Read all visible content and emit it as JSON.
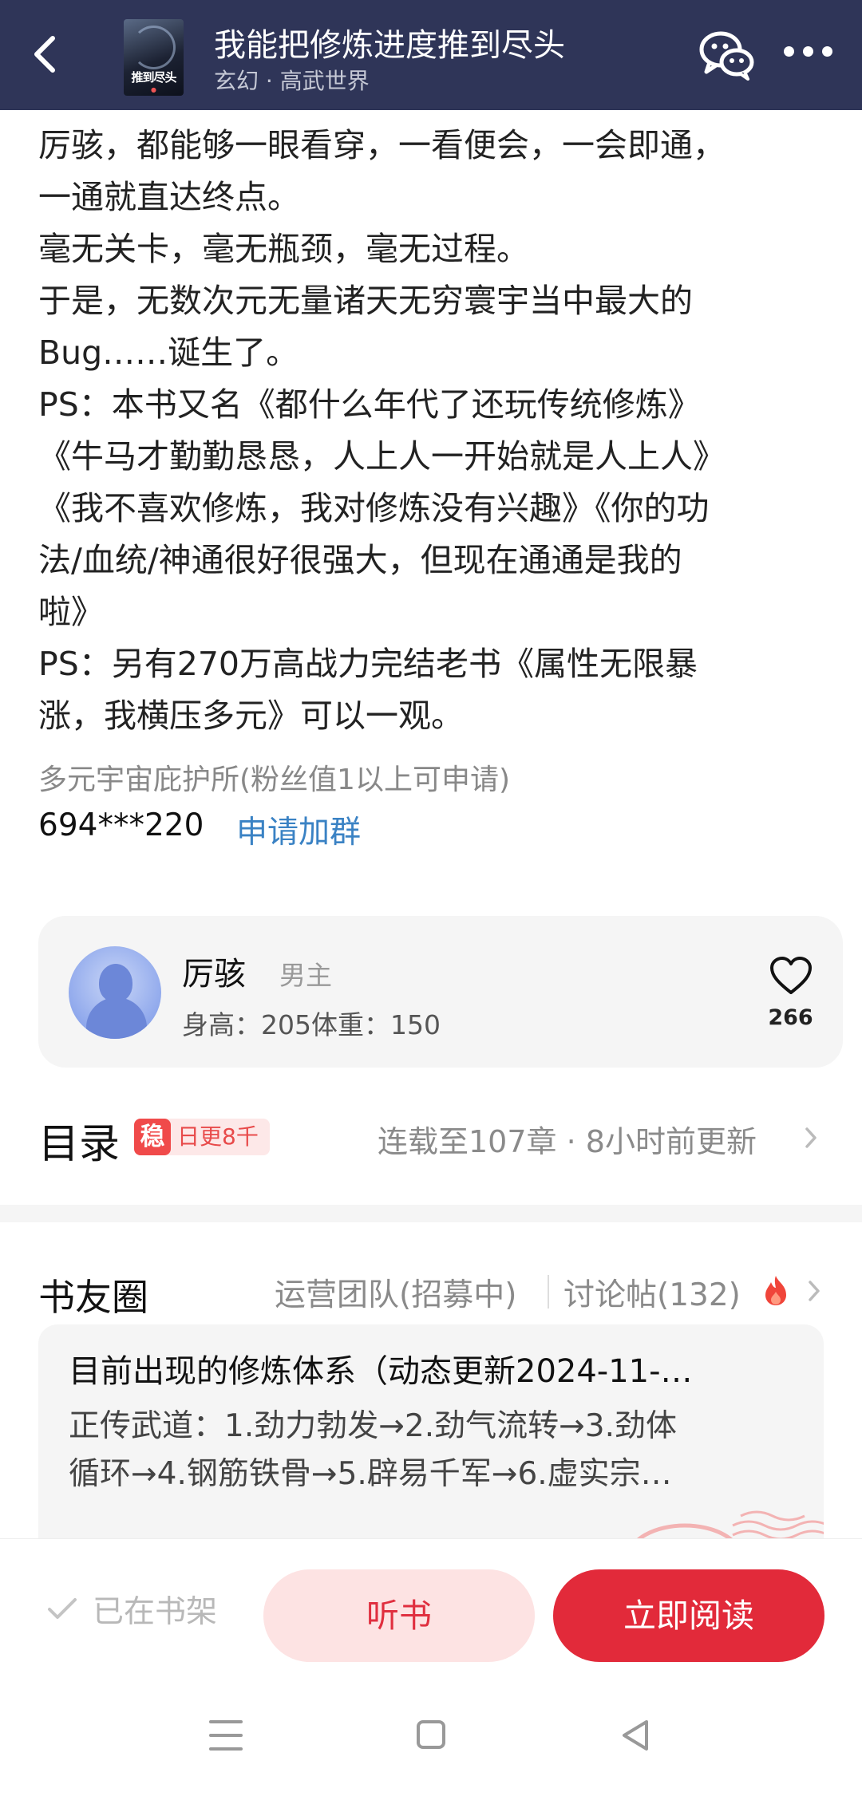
{
  "header": {
    "title": "我能把修炼进度推到尽头",
    "subtitle": "玄幻 · 高武世界",
    "cover_text": "推到尽头",
    "back_icon": "back-arrow-icon",
    "share_icon": "wechat-icon",
    "more_icon": "more-dots-icon",
    "bg_color": "#2f3558"
  },
  "description": {
    "lines": [
      "厉骇，都能够一眼看穿，一看便会，一会即通，",
      "一通就直达终点。",
      "毫无关卡，毫无瓶颈，毫无过程。",
      "于是，无数次元无量诸天无穷寰宇当中最大的",
      "Bug……诞生了。",
      "PS：本书又名《都什么年代了还玩传统修炼》",
      "《牛马才勤勤恳恳，人上人一开始就是人上人》",
      "《我不喜欢修炼，我对修炼没有兴趣》《你的功",
      "法/血统/神通很好很强大，但现在通通是我的",
      "啦》",
      "PS：另有270万高战力完结老书《属性无限暴",
      "涨，我横压多元》可以一观。"
    ],
    "fan_group": "多元宇宙庇护所(粉丝值1以上可申请)",
    "qq_number": "694***220",
    "join_label": "申请加群"
  },
  "character": {
    "name": "厉骇",
    "role": "男主",
    "stats": "身高：205体重：150",
    "likes": "266"
  },
  "catalog": {
    "title": "目录",
    "badge_icon_text": "稳",
    "badge_text": "日更8千",
    "status": "连载至107章 · 8小时前更新"
  },
  "book_friends": {
    "title": "书友圈",
    "ops_team": "运营团队(招募中)",
    "discussions": "讨论帖(132)",
    "post": {
      "title": "目前出现的修炼体系（动态更新2024-11-…",
      "lines": [
        "正传武道：1.劲力勃发→2.劲气流转→3.劲体",
        "循环→4.钢筋铁骨→5.辟易千军→6.虚实宗…"
      ]
    }
  },
  "actions": {
    "shelf": "已在书架",
    "listen": "听书",
    "read": "立即阅读",
    "accent_color": "#e22a3a"
  }
}
